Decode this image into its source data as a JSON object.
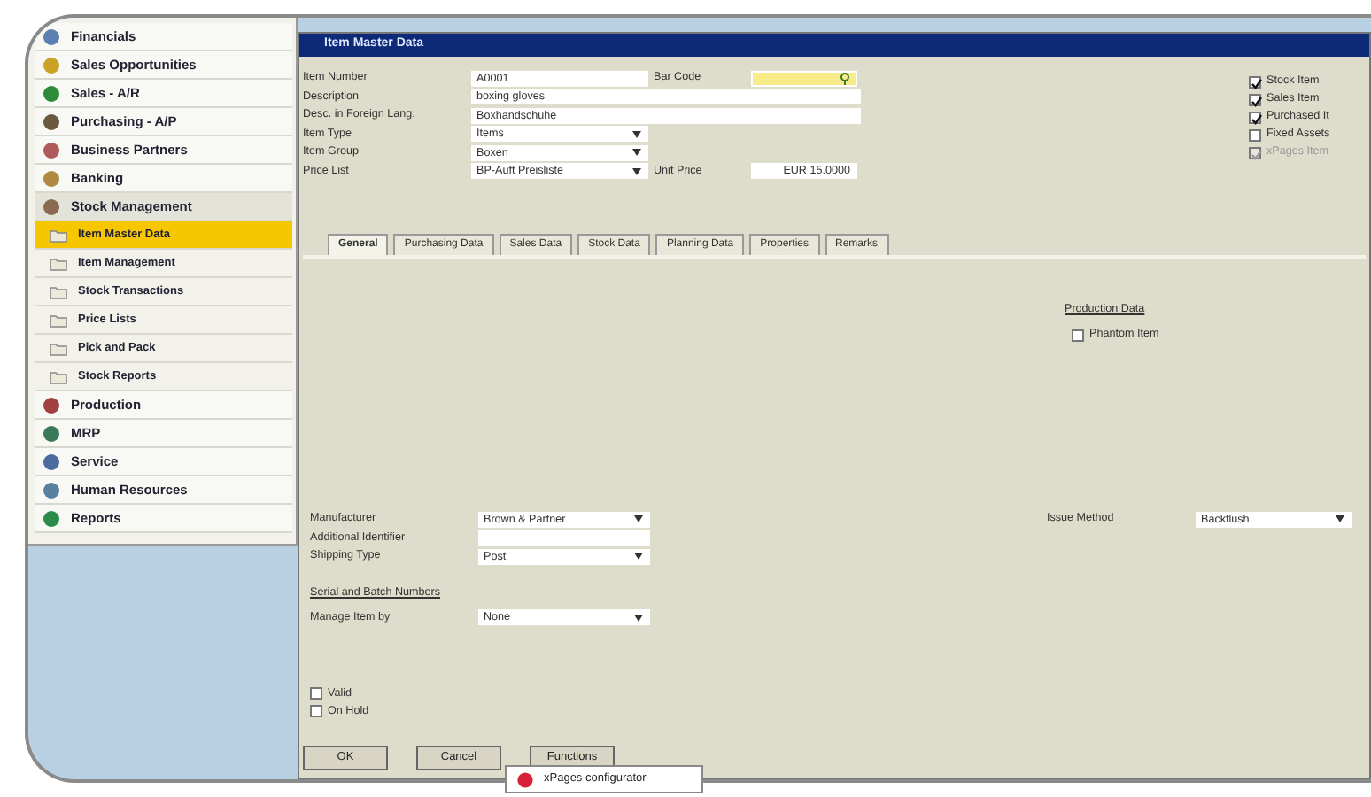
{
  "sidebar": {
    "items": [
      {
        "label": "Financials",
        "selected": false,
        "expanded": false
      },
      {
        "label": "Sales Opportunities",
        "selected": false,
        "expanded": false
      },
      {
        "label": "Sales - A/R",
        "selected": false,
        "expanded": false
      },
      {
        "label": "Purchasing - A/P",
        "selected": false,
        "expanded": false
      },
      {
        "label": "Business Partners",
        "selected": false,
        "expanded": false
      },
      {
        "label": "Banking",
        "selected": false,
        "expanded": false
      },
      {
        "label": "Stock Management",
        "selected": false,
        "expanded": true,
        "children": [
          {
            "label": "Item Master Data",
            "selected": true
          },
          {
            "label": "Item Management",
            "selected": false
          },
          {
            "label": "Stock Transactions",
            "selected": false
          },
          {
            "label": "Price Lists",
            "selected": false
          },
          {
            "label": "Pick and Pack",
            "selected": false
          },
          {
            "label": "Stock Reports",
            "selected": false
          }
        ]
      },
      {
        "label": "Production",
        "selected": false,
        "expanded": false
      },
      {
        "label": "MRP",
        "selected": false,
        "expanded": false
      },
      {
        "label": "Service",
        "selected": false,
        "expanded": false
      },
      {
        "label": "Human Resources",
        "selected": false,
        "expanded": false
      },
      {
        "label": "Reports",
        "selected": false,
        "expanded": false
      }
    ]
  },
  "window": {
    "title": "Item Master Data",
    "header_rows": [
      {
        "label": "Item Number",
        "value": "A0001",
        "kind": "text",
        "side": {
          "label": "Bar Code",
          "kind": "highlight"
        }
      },
      {
        "label": "Description",
        "value": "boxing gloves",
        "kind": "wide"
      },
      {
        "label": "Desc. in Foreign Lang.",
        "value": "Boxhandschuhe",
        "kind": "wide"
      },
      {
        "label": "Item Type",
        "value": "Items",
        "kind": "dropdown"
      },
      {
        "label": "Item Group",
        "value": "Boxen",
        "kind": "dropdown"
      },
      {
        "label": "Price List",
        "value": "BP-Auft Preisliste",
        "kind": "dropdown",
        "side": {
          "label": "Unit Price",
          "value": "EUR 15.0000",
          "kind": "text"
        }
      }
    ],
    "item_flags": [
      {
        "label": "Stock Item",
        "checked": true,
        "disabled": false
      },
      {
        "label": "Sales Item",
        "checked": true,
        "disabled": false
      },
      {
        "label": "Purchased It",
        "checked": true,
        "disabled": false
      },
      {
        "label": "Fixed Assets",
        "checked": false,
        "disabled": false
      },
      {
        "label": "xPages Item",
        "checked": true,
        "disabled": true
      }
    ],
    "tabs": [
      {
        "label": "General",
        "selected": true
      },
      {
        "label": "Purchasing Data",
        "selected": false
      },
      {
        "label": "Sales Data",
        "selected": false
      },
      {
        "label": "Stock Data",
        "selected": false
      },
      {
        "label": "Planning Data",
        "selected": false
      },
      {
        "label": "Properties",
        "selected": false
      },
      {
        "label": "Remarks",
        "selected": false
      }
    ],
    "production": {
      "heading": "Production Data",
      "checkbox": {
        "label": "Phantom Item",
        "checked": false
      }
    },
    "general_fields": [
      {
        "label": "Manufacturer",
        "value": "Brown & Partner",
        "kind": "dropdown"
      },
      {
        "label": "Additional Identifier",
        "kind": "text"
      },
      {
        "label": "Shipping Type",
        "value": "Post",
        "kind": "dropdown"
      }
    ],
    "issue_method": {
      "label": "Issue Method",
      "value": "Backflush"
    },
    "serial_link": "Serial and Batch Numbers",
    "manage_by": {
      "label": "Manage Item by",
      "value": "None"
    },
    "status": [
      {
        "label": "Valid",
        "checked": false
      },
      {
        "label": "On Hold",
        "checked": false
      }
    ],
    "buttons": [
      "OK",
      "Cancel",
      "Functions"
    ],
    "popup": {
      "label": "xPages configurator"
    }
  }
}
